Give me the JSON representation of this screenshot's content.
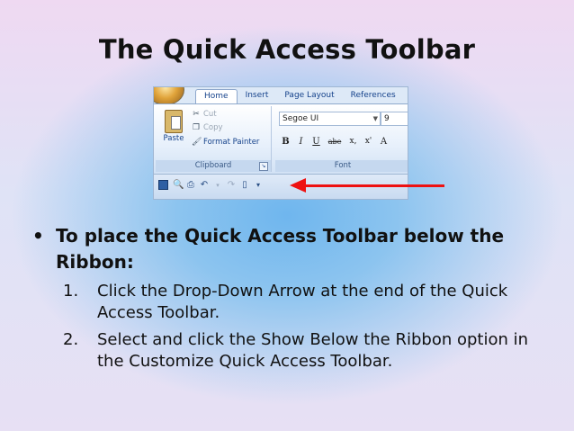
{
  "slide": {
    "title": "The Quick Access Toolbar",
    "bullet": "To place the Quick Access Toolbar below the Ribbon:",
    "steps": [
      {
        "num": "1.",
        "text": "Click the Drop-Down Arrow at the end of the Quick Access Toolbar."
      },
      {
        "num": "2.",
        "text": "Select and click the Show Below the Ribbon option in the Customize Quick Access Toolbar."
      }
    ]
  },
  "ribbon": {
    "tabs": [
      "Home",
      "Insert",
      "Page Layout",
      "References"
    ],
    "clipboard": {
      "paste": "Paste",
      "cut": "Cut",
      "copy": "Copy",
      "format_painter": "Format Painter",
      "label": "Clipboard"
    },
    "font": {
      "name": "Segoe UI",
      "size": "9",
      "label": "Font",
      "buttons": [
        "B",
        "I",
        "U",
        "abe",
        "x,",
        "x'",
        "A"
      ]
    }
  },
  "quick_access_toolbar": {
    "icons": [
      "save-icon",
      "print-preview-icon",
      "print-icon",
      "undo-icon",
      "redo-icon",
      "new-document-icon",
      "customize-dropdown-icon"
    ]
  },
  "colors": {
    "arrow": "#ee1111",
    "ribbon_text": "#15428b"
  }
}
